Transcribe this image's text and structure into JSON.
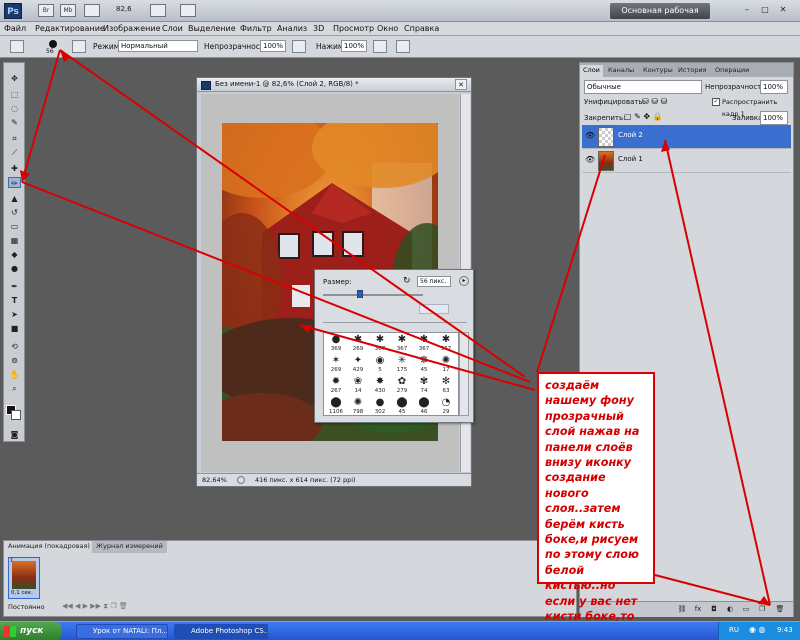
{
  "app_bar": {
    "logo": "Ps",
    "icons": [
      "Br",
      "Mb"
    ],
    "zoom": "82,6",
    "workspace_button": "Основная рабочая среда",
    "window_buttons": [
      "–",
      "□",
      "✕"
    ]
  },
  "menu": [
    "Файл",
    "Редактирование",
    "Изображение",
    "Слои",
    "Выделение",
    "Фильтр",
    "Анализ",
    "3D",
    "Просмотр",
    "Окно",
    "Справка"
  ],
  "options": {
    "brush_size": "56",
    "mode_label": "Режим:",
    "mode_value": "Нормальный",
    "opacity_label": "Непрозрачность:",
    "opacity_value": "100%",
    "pressure_label": "Нажим:",
    "pressure_value": "100%"
  },
  "document": {
    "title": "Без имени-1 @ 82,6% (Слой 2, RGB/8) *",
    "status_zoom": "82,64%",
    "status_info": "416 пикс. x 614 пикс. (72 ppi)"
  },
  "brush_picker": {
    "size_label": "Размер:",
    "size_value": "56 пикс.",
    "brushes": [
      [
        "369",
        "269",
        "367",
        "367",
        "367",
        "367"
      ],
      [
        "269",
        "429",
        "5",
        "175",
        "45",
        "17"
      ],
      [
        "267",
        "14",
        "430",
        "279",
        "74",
        "63"
      ],
      [
        "1106",
        "798",
        "302",
        "45",
        "46",
        "29"
      ]
    ]
  },
  "layers_panel": {
    "tabs": [
      "Слои",
      "Каналы",
      "Контуры",
      "История",
      "Операции"
    ],
    "blend_mode": "Обычные",
    "opacity_label": "Непрозрачность:",
    "opacity_value": "100%",
    "unify_label": "Унифицировать:",
    "propagate_label": "Распространить кадр 1",
    "lock_label": "Закрепить:",
    "fill_label": "Заливка:",
    "fill_value": "100%",
    "layers": [
      {
        "name": "Слой 2",
        "selected": true
      },
      {
        "name": "Слой 1",
        "selected": false
      }
    ]
  },
  "animation_panel": {
    "tabs": [
      "Анимация (покадровая)",
      "Журнал измерений"
    ],
    "frame_number": "1",
    "frame_time": "0,1 сек.",
    "loop": "Постоянно"
  },
  "annotation": "создаём нашему фону прозрачный слой нажав на панели слоёв внизу иконку создание нового слоя..затем берём кисть боке,и рисуем по этому слою белой кистью..но если у вас нет кисти боке,то её можно сделать самому",
  "taskbar": {
    "start": "пуск",
    "tasks": [
      "Урок от NATALI: Пл...",
      "Adobe Photoshop CS..."
    ],
    "lang": "RU",
    "time": "9:43"
  },
  "colors": {
    "arrow": "#d80000",
    "selected_layer": "#3a6fcf"
  }
}
